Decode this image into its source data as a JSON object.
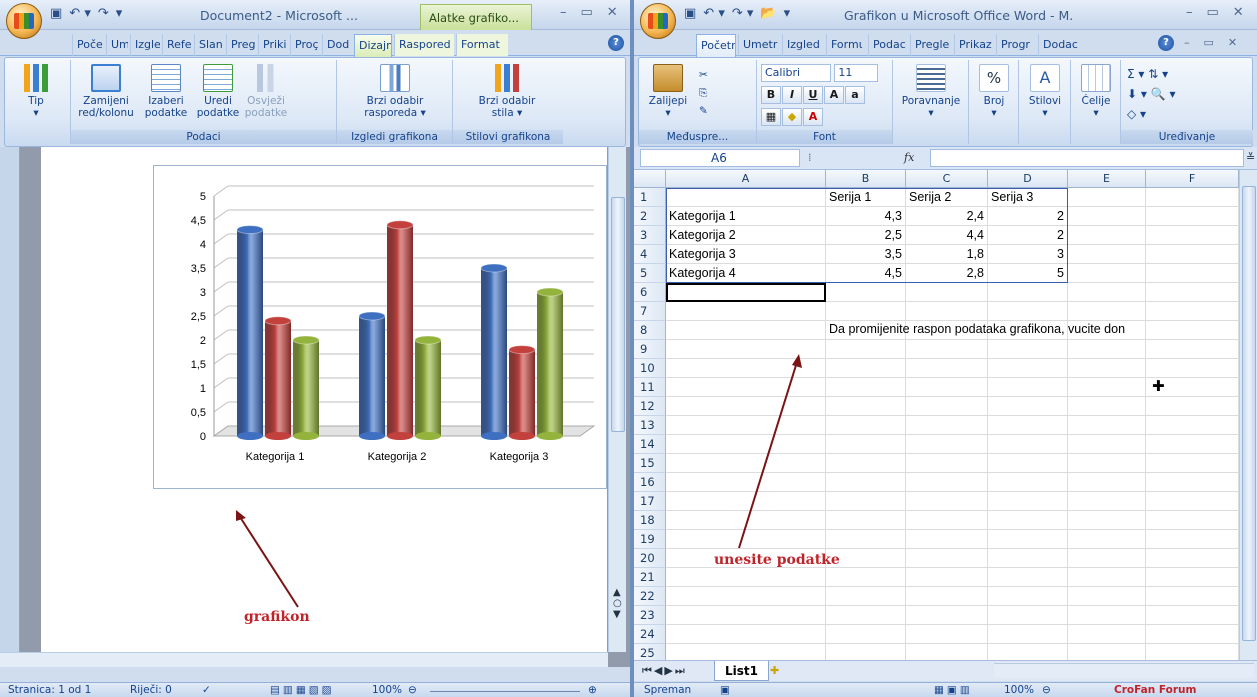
{
  "word": {
    "title": "Document2 - Microsoft ...",
    "context_tab": "Alatke grafiko...",
    "tabs": [
      "Poče",
      "Ume",
      "Izgle",
      "Refe",
      "Slan",
      "Preg",
      "Priki",
      "Proç",
      "Dod",
      "Dizajn",
      "Raspored",
      "Format"
    ],
    "active_tab": "Dizajn",
    "ribbon": {
      "tip": "Tip",
      "switch": "Zamijeni\nred/kolonu",
      "select": "Izaberi\npodatke",
      "edit": "Uredi\npodatke",
      "refresh": "Osvježi\npodatke",
      "quick_layout": "Brzi odabir\nrasporeda ▾",
      "quick_style": "Brzi odabir\nstila ▾",
      "group_data": "Podaci",
      "group_layouts": "Izgledi grafikona",
      "group_styles": "Stilovi grafikona"
    },
    "status": {
      "page": "Stranica: 1 od 1",
      "words": "Riječi: 0",
      "zoom": "100%"
    },
    "annotation": "grafikon"
  },
  "excel": {
    "title": "Grafikon u Microsoft Office Word - M.",
    "tabs": [
      "Početr",
      "Umetr",
      "Izgled",
      "Formι",
      "Podac",
      "Pregle",
      "Prikaz",
      "Progr",
      "Dodac"
    ],
    "active_tab": "Početr",
    "ribbon": {
      "paste": "Zalijepi",
      "clipboard": "Međuspre...",
      "font_name": "Calibri",
      "font_size": "11",
      "font_group": "Font",
      "alignment": "Poravnanje",
      "number": "Broj",
      "styles": "Stilovi",
      "cells": "Ćelije",
      "editing": "Uređivanje"
    },
    "name_box": "A6",
    "fx": "fx",
    "columns": [
      "A",
      "B",
      "C",
      "D",
      "E",
      "F"
    ],
    "rows": [
      "1",
      "2",
      "3",
      "4",
      "5",
      "6",
      "7",
      "8",
      "9",
      "10",
      "11",
      "12",
      "13",
      "14",
      "15",
      "16",
      "17",
      "18",
      "19",
      "20",
      "21",
      "22",
      "23",
      "24",
      "25"
    ],
    "header_row": [
      "",
      "Serija 1",
      "Serija 2",
      "Serija 3"
    ],
    "data_rows": [
      [
        "Kategorija 1",
        "4,3",
        "2,4",
        "2"
      ],
      [
        "Kategorija 2",
        "2,5",
        "4,4",
        "2"
      ],
      [
        "Kategorija 3",
        "3,5",
        "1,8",
        "3"
      ],
      [
        "Kategorija 4",
        "4,5",
        "2,8",
        "5"
      ]
    ],
    "note": "Da promijenite raspon podataka grafikona, vucite don",
    "sheet_tab": "List1",
    "status_ready": "Spreman",
    "zoom": "100%",
    "watermark": "CroFan Forum",
    "annotation": "unesite podatke"
  },
  "chart_data": {
    "type": "bar",
    "categories": [
      "Kategorija 1",
      "Kategorija 2",
      "Kategorija 3"
    ],
    "series": [
      {
        "values": [
          4.3,
          2.5,
          3.5
        ]
      },
      {
        "values": [
          2.4,
          4.4,
          1.8
        ]
      },
      {
        "values": [
          2,
          2,
          3
        ]
      }
    ],
    "colors": [
      "#3f6fc0",
      "#c2413d",
      "#93b33c"
    ],
    "ylim": [
      0,
      5
    ],
    "yticks": [
      "0",
      "0,5",
      "1",
      "1,5",
      "2",
      "2,5",
      "3",
      "3,5",
      "4",
      "4,5",
      "5"
    ],
    "grid": true
  }
}
